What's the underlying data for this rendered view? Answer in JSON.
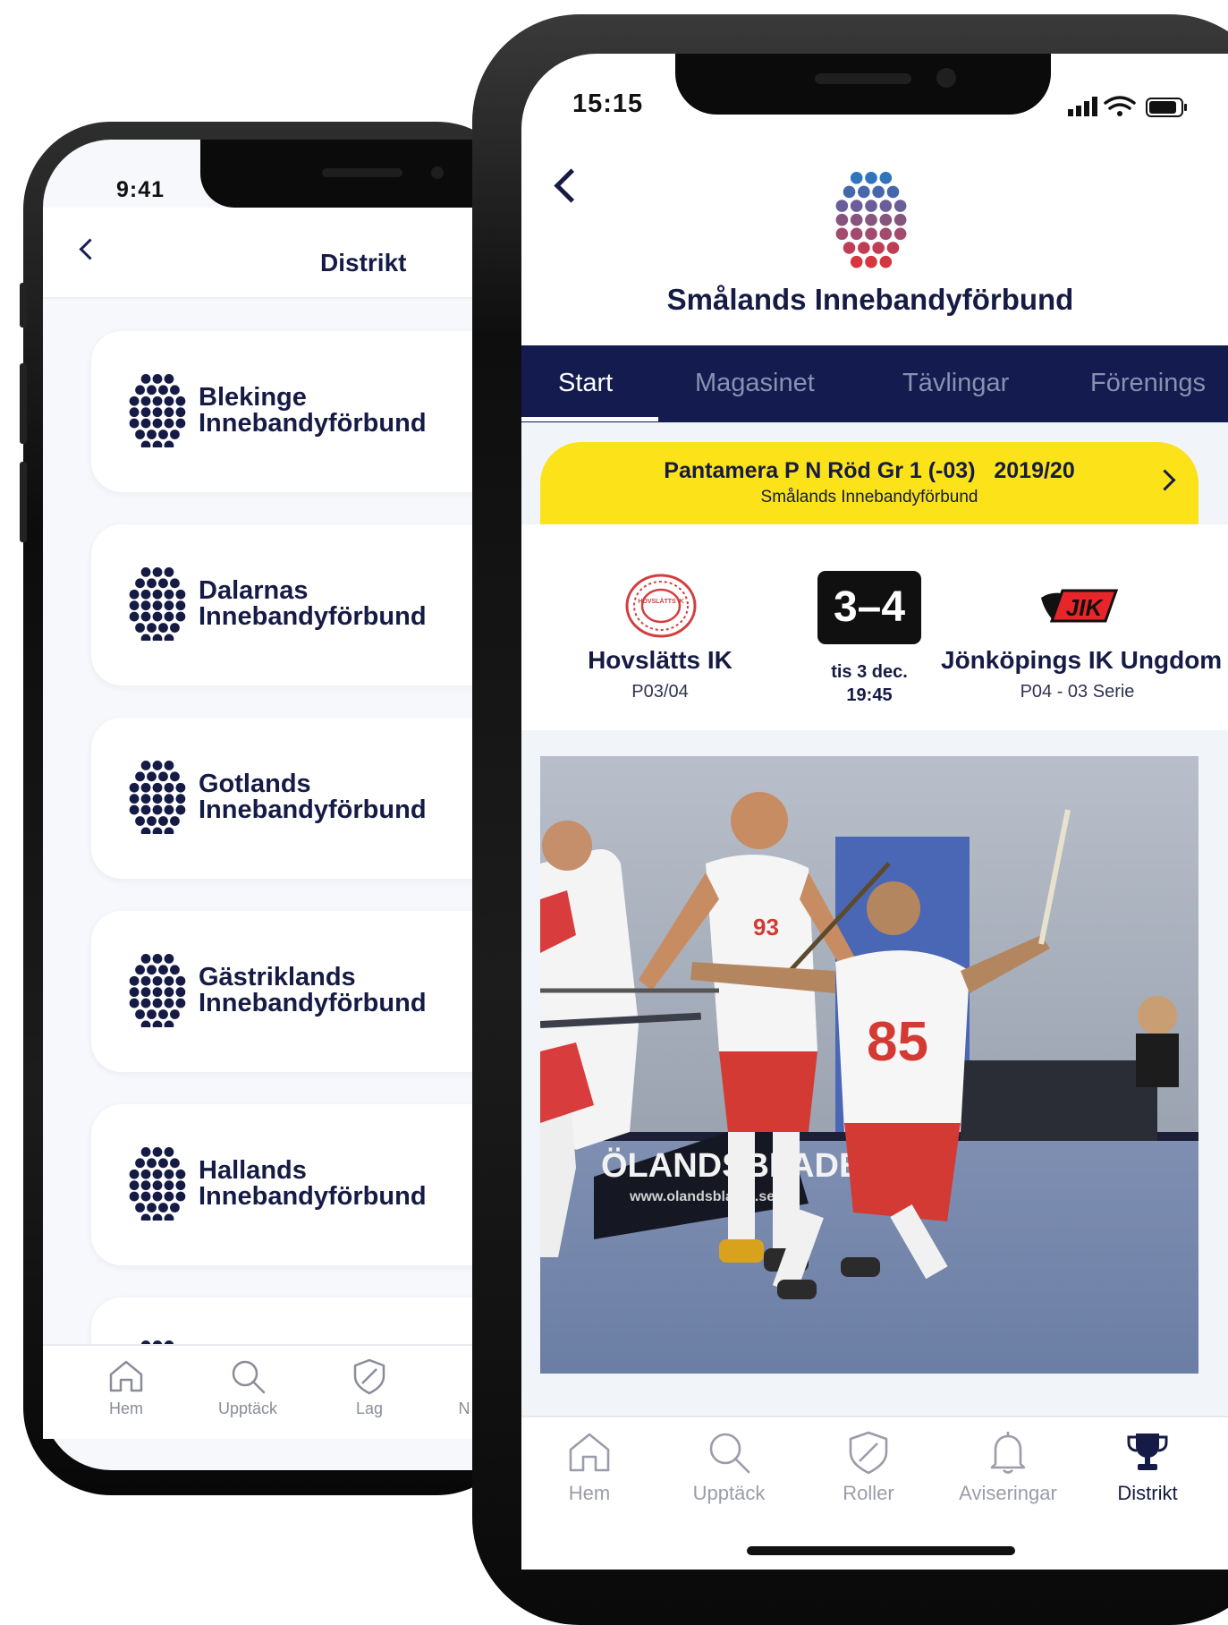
{
  "back_phone": {
    "status_time": "9:41",
    "header_title": "Distrikt",
    "districts": [
      {
        "line1": "Blekinge",
        "line2": "Innebandyförbund"
      },
      {
        "line1": "Dalarnas",
        "line2": "Innebandyförbund"
      },
      {
        "line1": "Gotlands",
        "line2": "Innebandyförbund"
      },
      {
        "line1": "Gästriklands",
        "line2": "Innebandyförbund"
      },
      {
        "line1": "Hallands",
        "line2": "Innebandyförbund"
      }
    ],
    "tabbar": [
      {
        "label": "Hem",
        "icon": "home-icon"
      },
      {
        "label": "Upptäck",
        "icon": "search-icon"
      },
      {
        "label": "Lag",
        "icon": "shield-icon"
      },
      {
        "label": "N",
        "icon": "bell-icon"
      }
    ]
  },
  "front_phone": {
    "status_time": "15:15",
    "org_title": "Smålands Innebandyförbund",
    "tabs": [
      "Start",
      "Magasinet",
      "Tävlingar",
      "Förenings"
    ],
    "active_tab": "Start",
    "banner": {
      "title": "Pantamera P N Röd Gr 1 (-03)   2019/20",
      "subtitle": "Smålands Innebandyförbund"
    },
    "match": {
      "home_team": "Hovslätts IK",
      "home_division": "P03/04",
      "away_team": "Jönköpings IK Ungdom",
      "away_division": "P04 - 03 Serie",
      "score": "3–4",
      "date": "tis 3 dec.",
      "time": "19:45",
      "home_logo_text": "HOVSLÄTTS IK",
      "away_logo_text": "JIK"
    },
    "photo": {
      "jersey_number_1": "85",
      "jersey_number_2": "93",
      "banner_text": "ÖLANDSBLADET",
      "banner_url": "www.olandsbladet.se"
    },
    "tabbar": [
      {
        "label": "Hem",
        "icon": "home-icon"
      },
      {
        "label": "Upptäck",
        "icon": "search-icon"
      },
      {
        "label": "Roller",
        "icon": "shield-icon"
      },
      {
        "label": "Aviseringar",
        "icon": "bell-icon"
      },
      {
        "label": "Distrikt",
        "icon": "trophy-icon"
      }
    ],
    "active_nav": "Distrikt"
  },
  "colors": {
    "navy": "#161b45",
    "tab_bar_bg": "#131b4f",
    "banner_yellow": "#fbe219",
    "inactive_gray": "#9a9caa"
  }
}
